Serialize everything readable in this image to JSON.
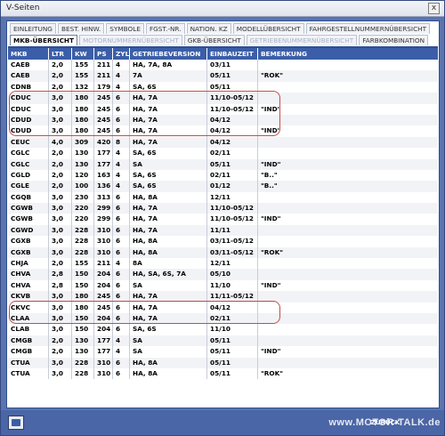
{
  "window": {
    "title": "V-Seiten",
    "close_glyph": "x"
  },
  "tabs_row1": [
    "EINLEITUNG",
    "BEST. HINW.",
    "SYMBOLE",
    "FGST.-NR.",
    "NATION. KZ",
    "MODELLÜBERSICHT",
    "FAHRGESTELLNUMMERNÜBERSICHT"
  ],
  "tabs_row2": [
    {
      "label": "MKB-ÜBERSICHT",
      "state": "active"
    },
    {
      "label": "MOTORNUMMERNÜBERSICHT",
      "state": "grey"
    },
    {
      "label": "GKB-ÜBERSICHT",
      "state": "normal"
    },
    {
      "label": "GETRIEBENUMMERNÜBERSICHT",
      "state": "grey"
    },
    {
      "label": "FARBKOMBINATION",
      "state": "normal"
    }
  ],
  "table": {
    "headers": [
      "MKB",
      "LTR",
      "KW",
      "PS",
      "ZYL",
      "GETRIEBEVERSION",
      "EINBAUZEIT",
      "BEMERKUNG"
    ],
    "rows": [
      [
        "CAEB",
        "2,0",
        "155",
        "211",
        "4",
        "HA, 7A, 8A",
        "03/11",
        ""
      ],
      [
        "CAEB",
        "2,0",
        "155",
        "211",
        "4",
        "7A",
        "05/11",
        "\"ROK\""
      ],
      [
        "CDNB",
        "2,0",
        "132",
        "179",
        "4",
        "SA, 6S",
        "05/11",
        ""
      ],
      [
        "CDUC",
        "3,0",
        "180",
        "245",
        "6",
        "HA, 7A",
        "11/10-05/12",
        ""
      ],
      [
        "CDUC",
        "3,0",
        "180",
        "245",
        "6",
        "HA, 7A",
        "11/10-05/12",
        "\"IND\""
      ],
      [
        "CDUD",
        "3,0",
        "180",
        "245",
        "6",
        "HA, 7A",
        "04/12",
        ""
      ],
      [
        "CDUD",
        "3,0",
        "180",
        "245",
        "6",
        "HA, 7A",
        "04/12",
        "\"IND\""
      ],
      [
        "CEUC",
        "4,0",
        "309",
        "420",
        "8",
        "HA, 7A",
        "04/12",
        ""
      ],
      [
        "CGLC",
        "2,0",
        "130",
        "177",
        "4",
        "SA, 6S",
        "02/11",
        ""
      ],
      [
        "CGLC",
        "2,0",
        "130",
        "177",
        "4",
        "SA",
        "05/11",
        "\"IND\""
      ],
      [
        "CGLD",
        "2,0",
        "120",
        "163",
        "4",
        "SA, 6S",
        "02/11",
        "\"B..\""
      ],
      [
        "CGLE",
        "2,0",
        "100",
        "136",
        "4",
        "SA, 6S",
        "01/12",
        "\"B..\""
      ],
      [
        "CGQB",
        "3,0",
        "230",
        "313",
        "6",
        "HA, 8A",
        "12/11",
        ""
      ],
      [
        "CGWB",
        "3,0",
        "220",
        "299",
        "6",
        "HA, 7A",
        "11/10-05/12",
        ""
      ],
      [
        "CGWB",
        "3,0",
        "220",
        "299",
        "6",
        "HA, 7A",
        "11/10-05/12",
        "\"IND\""
      ],
      [
        "CGWD",
        "3,0",
        "228",
        "310",
        "6",
        "HA, 7A",
        "11/11",
        ""
      ],
      [
        "CGXB",
        "3,0",
        "228",
        "310",
        "6",
        "HA, 8A",
        "03/11-05/12",
        ""
      ],
      [
        "CGXB",
        "3,0",
        "228",
        "310",
        "6",
        "HA, 8A",
        "03/11-05/12",
        "\"ROK\""
      ],
      [
        "CHJA",
        "2,0",
        "155",
        "211",
        "4",
        "8A",
        "12/11",
        ""
      ],
      [
        "CHVA",
        "2,8",
        "150",
        "204",
        "6",
        "HA, SA, 6S, 7A",
        "05/10",
        ""
      ],
      [
        "CHVA",
        "2,8",
        "150",
        "204",
        "6",
        "SA",
        "11/10",
        "\"IND\""
      ],
      [
        "CKVB",
        "3,0",
        "180",
        "245",
        "6",
        "HA, 7A",
        "11/11-05/12",
        ""
      ],
      [
        "CKVC",
        "3,0",
        "180",
        "245",
        "6",
        "HA, 7A",
        "04/12",
        ""
      ],
      [
        "CLAA",
        "3,0",
        "150",
        "204",
        "6",
        "HA, 7A",
        "02/11",
        ""
      ],
      [
        "CLAB",
        "3,0",
        "150",
        "204",
        "6",
        "SA, 6S",
        "11/10",
        ""
      ],
      [
        "CMGB",
        "2,0",
        "130",
        "177",
        "4",
        "SA",
        "05/11",
        ""
      ],
      [
        "CMGB",
        "2,0",
        "130",
        "177",
        "4",
        "SA",
        "05/11",
        "\"IND\""
      ],
      [
        "CTUA",
        "3,0",
        "228",
        "310",
        "6",
        "HA, 8A",
        "05/11",
        ""
      ],
      [
        "CTUA",
        "3,0",
        "228",
        "310",
        "6",
        "HA, 8A",
        "05/11",
        "\"ROK\""
      ]
    ]
  },
  "footer": {
    "back_label": "ZURÜCK",
    "watermark": "www.MOTOR-TALK.de",
    "print_icon": "printer-icon"
  },
  "colors": {
    "header_bg": "#3b5ea8",
    "frame": "#5a74b0",
    "highlight": "#c44d4d"
  }
}
